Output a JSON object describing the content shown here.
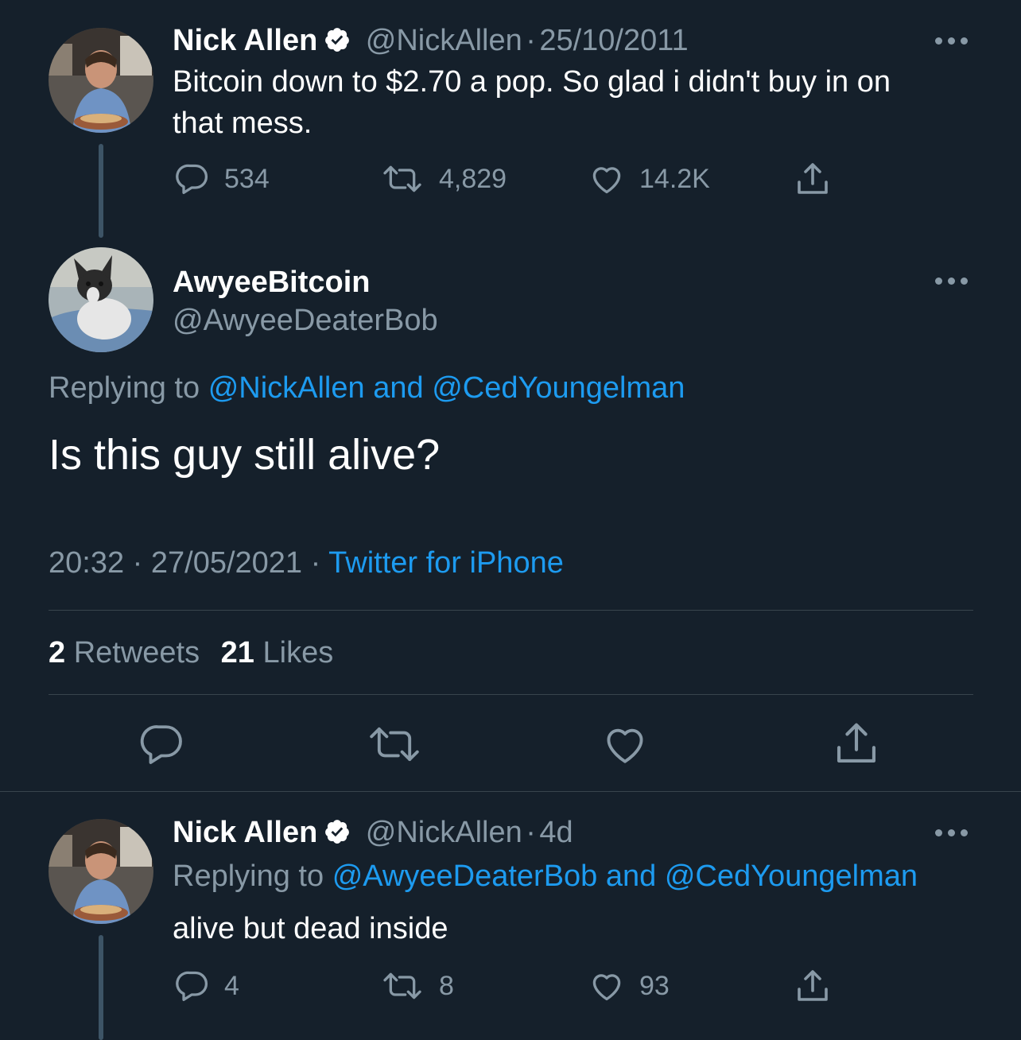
{
  "tweet1": {
    "name": "Nick Allen",
    "handle": "@NickAllen",
    "sep": "·",
    "date": "25/10/2011",
    "text_line1": "Bitcoin down to $2.70 a pop. So glad i didn't buy in on",
    "text_line2": "that mess.",
    "replies": "534",
    "retweets": "4,829",
    "likes": "14.2K"
  },
  "main_tweet": {
    "name": "AwyeeBitcoin",
    "handle": "@AwyeeDeaterBob",
    "replying_prefix": "Replying to",
    "replying_user1": "@NickAllen",
    "replying_and": "and",
    "replying_user2": "@CedYoungelman",
    "text": "Is this guy still alive?",
    "time": "20:32",
    "sep1": "·",
    "date": "27/05/2021",
    "sep2": "·",
    "source": "Twitter for iPhone",
    "retweet_count": "2",
    "retweet_label": "Retweets",
    "like_count": "21",
    "like_label": "Likes"
  },
  "reply": {
    "name": "Nick Allen",
    "handle": "@NickAllen",
    "sep": "·",
    "age": "4d",
    "replying_prefix": "Replying to",
    "replying_user1": "@AwyeeDeaterBob",
    "replying_and": "and",
    "replying_user2": "@CedYoungelman",
    "text": "alive but dead inside",
    "replies": "4",
    "retweets": "8",
    "likes": "93"
  },
  "colors": {
    "background": "#15202b",
    "muted": "#8899a6",
    "link": "#1d9bf0",
    "verified": "#ffffff"
  },
  "icons": [
    "reply-icon",
    "retweet-icon",
    "like-icon",
    "share-icon",
    "verified-icon",
    "more-icon"
  ]
}
